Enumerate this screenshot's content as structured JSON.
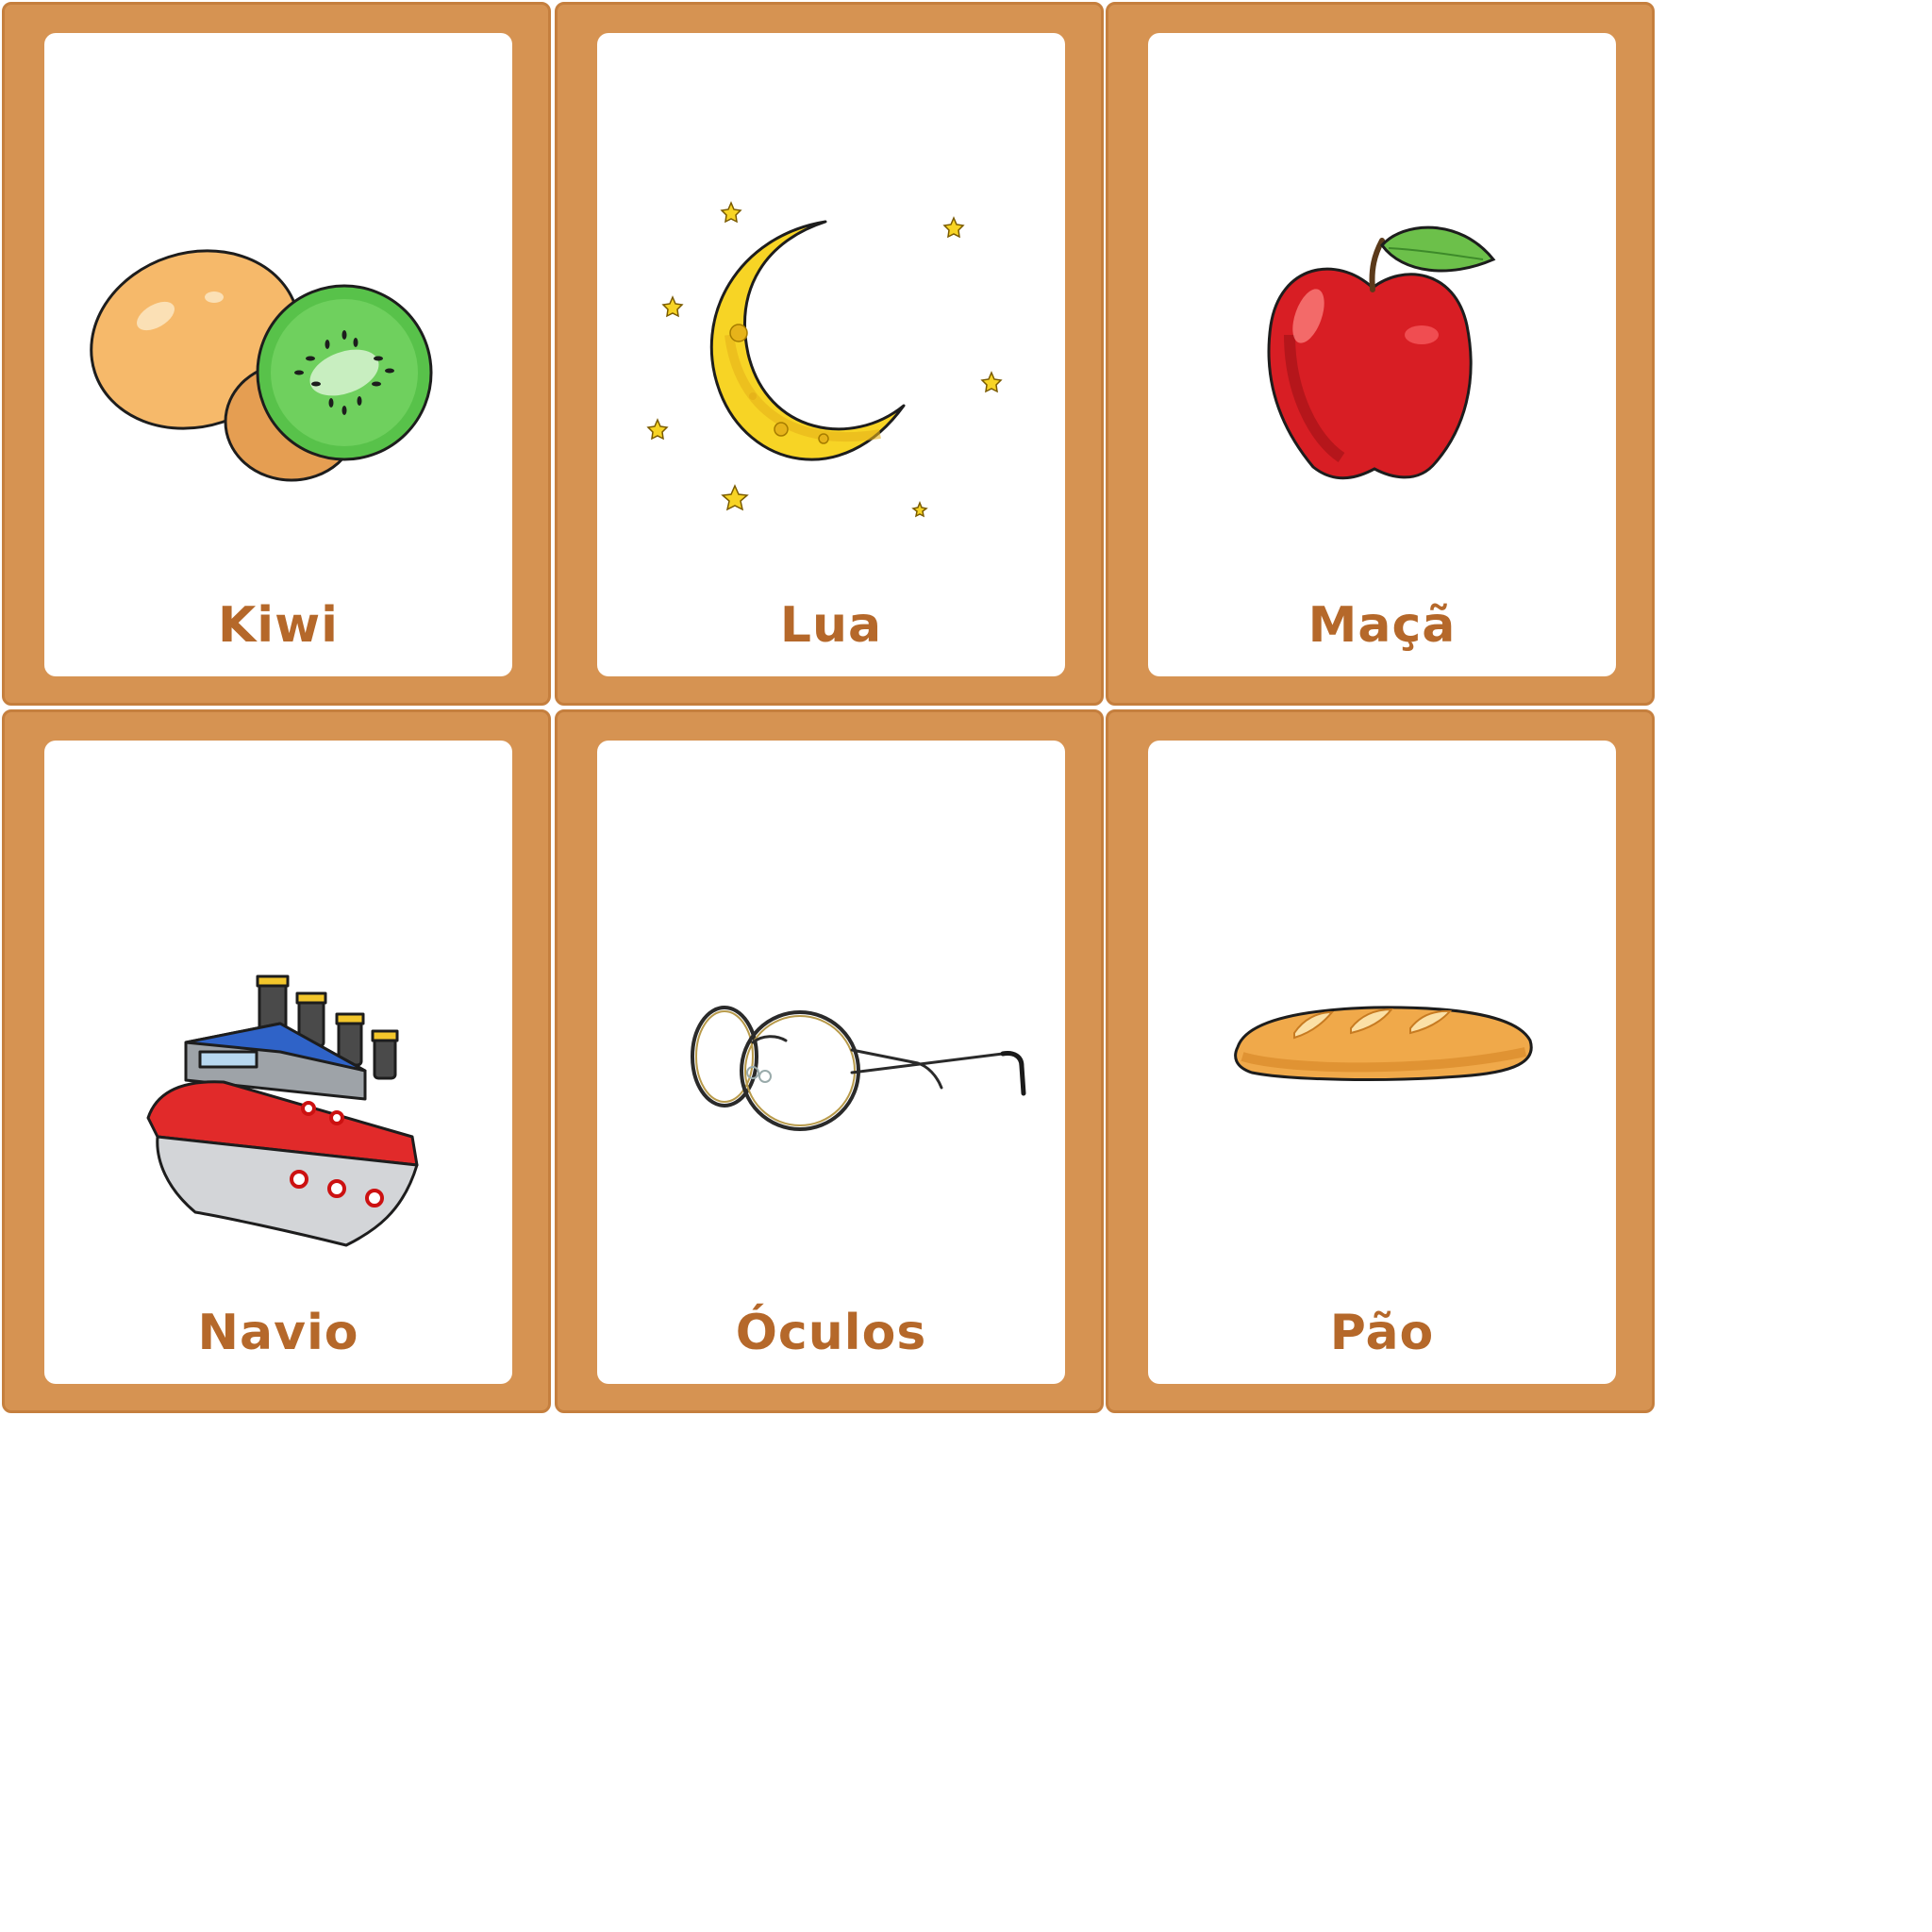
{
  "cards": [
    {
      "label": "Kiwi",
      "icon": "kiwi-icon"
    },
    {
      "label": "Lua",
      "icon": "moon-icon"
    },
    {
      "label": "Maçã",
      "icon": "apple-icon"
    },
    {
      "label": "Navio",
      "icon": "ship-icon"
    },
    {
      "label": "Óculos",
      "icon": "glasses-icon"
    },
    {
      "label": "Pão",
      "icon": "bread-icon"
    }
  ],
  "colors": {
    "frame": "#d69352",
    "frame_border": "#c57f3e",
    "label": "#b5682a",
    "card": "#ffffff"
  }
}
